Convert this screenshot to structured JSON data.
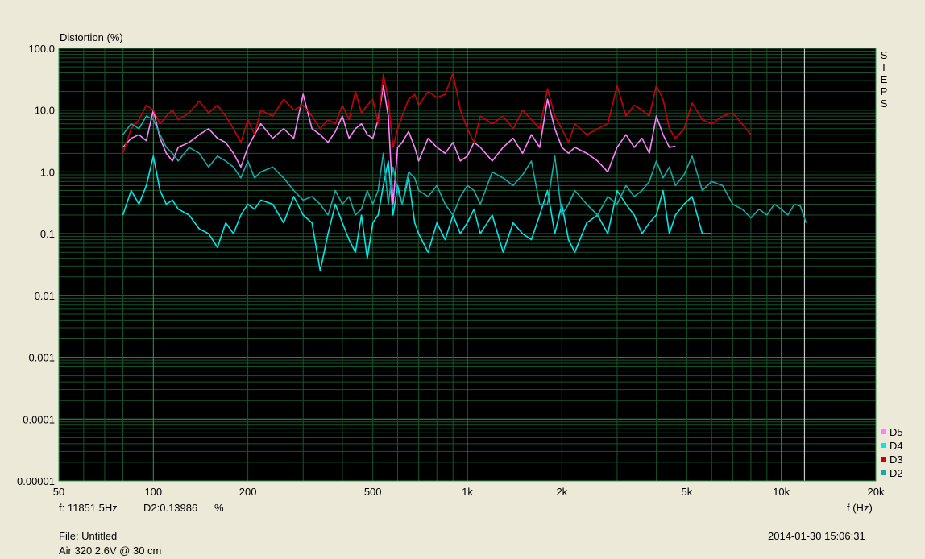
{
  "ylabel": "Distortion (%)",
  "xlabel": "f (Hz)",
  "side_label": "STEPS",
  "cursor": {
    "freq_text": "f: 11851.5Hz",
    "value_text": "D2:0.13986",
    "unit": "%"
  },
  "file_text": "File: Untitled",
  "description": "Air 320 2.6V @ 30 cm",
  "timestamp": "2014-01-30 15:06:31",
  "colors": {
    "background": "#ece9d8",
    "plot": "#000000",
    "grid_major": "#2e9a4e",
    "grid_minor": "#16552a",
    "cursor": "#c8c8c8"
  },
  "chart_data": {
    "type": "line",
    "xscale": "log",
    "yscale": "log",
    "xlim": [
      50,
      20000
    ],
    "ylim": [
      1e-05,
      100
    ],
    "grid": true,
    "legend_position": "bottom-right",
    "x_ticks": [
      {
        "value": 50,
        "label": "50"
      },
      {
        "value": 100,
        "label": "100"
      },
      {
        "value": 200,
        "label": "200"
      },
      {
        "value": 500,
        "label": "500"
      },
      {
        "value": 1000,
        "label": "1k"
      },
      {
        "value": 2000,
        "label": "2k"
      },
      {
        "value": 5000,
        "label": "5k"
      },
      {
        "value": 10000,
        "label": "10k"
      },
      {
        "value": 20000,
        "label": "20k"
      }
    ],
    "y_ticks": [
      {
        "value": 100,
        "label": "100.0"
      },
      {
        "value": 10,
        "label": "10.0"
      },
      {
        "value": 1,
        "label": "1.0"
      },
      {
        "value": 0.1,
        "label": "0.1"
      },
      {
        "value": 0.01,
        "label": "0.01"
      },
      {
        "value": 0.001,
        "label": "0.001"
      },
      {
        "value": 0.0001,
        "label": "0.0001"
      },
      {
        "value": 1e-05,
        "label": "0.00001"
      }
    ],
    "cursor_x": 11851.5,
    "series": [
      {
        "name": "D5",
        "color": "#ff80ff",
        "x": [
          80,
          85,
          90,
          95,
          100,
          105,
          110,
          115,
          120,
          130,
          140,
          150,
          160,
          170,
          180,
          190,
          200,
          210,
          220,
          240,
          260,
          280,
          300,
          320,
          340,
          360,
          380,
          400,
          420,
          440,
          460,
          480,
          500,
          520,
          540,
          560,
          580,
          600,
          620,
          650,
          680,
          700,
          750,
          800,
          850,
          900,
          950,
          1000,
          1050,
          1100,
          1200,
          1300,
          1400,
          1500,
          1600,
          1700,
          1800,
          1900,
          2000,
          2100,
          2200,
          2400,
          2600,
          2800,
          3000,
          3200,
          3400,
          3600,
          3800,
          4000,
          4200,
          4400,
          4600
        ],
        "values": [
          2.5,
          3.5,
          4.0,
          3.2,
          10.0,
          3.5,
          2.0,
          1.5,
          2.5,
          3.0,
          4.0,
          5.0,
          3.5,
          3.0,
          2.0,
          1.2,
          2.5,
          4.0,
          6.0,
          3.5,
          5.0,
          3.5,
          18.0,
          5.0,
          4.0,
          3.0,
          4.5,
          8.0,
          3.5,
          5.0,
          6.0,
          4.0,
          3.5,
          7.0,
          25.0,
          8.0,
          0.3,
          2.5,
          3.0,
          4.5,
          2.5,
          1.5,
          3.5,
          2.5,
          2.0,
          3.0,
          1.5,
          1.8,
          3.0,
          2.5,
          1.5,
          2.5,
          3.5,
          2.0,
          4.0,
          2.5,
          15.0,
          5.0,
          2.5,
          2.0,
          2.5,
          2.0,
          1.5,
          1.0,
          2.5,
          4.0,
          2.5,
          3.5,
          2.0,
          8.0,
          4.0,
          2.5,
          2.6
        ]
      },
      {
        "name": "D4",
        "color": "#00e8e8",
        "x": [
          80,
          85,
          90,
          95,
          100,
          105,
          110,
          115,
          120,
          130,
          140,
          150,
          160,
          170,
          180,
          190,
          200,
          210,
          220,
          240,
          260,
          280,
          300,
          320,
          340,
          360,
          380,
          400,
          420,
          440,
          460,
          480,
          500,
          520,
          540,
          560,
          580,
          600,
          620,
          650,
          680,
          700,
          750,
          800,
          850,
          900,
          950,
          1000,
          1050,
          1100,
          1200,
          1300,
          1400,
          1500,
          1600,
          1700,
          1800,
          1900,
          2000,
          2100,
          2200,
          2400,
          2600,
          2800,
          3000,
          3200,
          3400,
          3600,
          3800,
          4000,
          4200,
          4400,
          4600,
          4900,
          5200,
          5600,
          6000
        ],
        "values": [
          0.2,
          0.5,
          0.3,
          0.6,
          1.8,
          0.5,
          0.3,
          0.35,
          0.25,
          0.2,
          0.12,
          0.1,
          0.06,
          0.15,
          0.1,
          0.2,
          0.3,
          0.25,
          0.35,
          0.3,
          0.15,
          0.4,
          0.2,
          0.15,
          0.025,
          0.1,
          0.3,
          0.15,
          0.08,
          0.05,
          0.2,
          0.04,
          0.15,
          0.2,
          0.6,
          1.5,
          0.2,
          0.6,
          0.3,
          0.8,
          0.15,
          0.1,
          0.05,
          0.15,
          0.08,
          0.2,
          0.1,
          0.15,
          0.25,
          0.1,
          0.2,
          0.05,
          0.15,
          0.1,
          0.08,
          0.2,
          0.5,
          0.1,
          0.3,
          0.08,
          0.05,
          0.15,
          0.2,
          0.1,
          0.5,
          0.3,
          0.2,
          0.1,
          0.15,
          0.2,
          0.5,
          0.1,
          0.2,
          0.3,
          0.4,
          0.1,
          0.1
        ]
      },
      {
        "name": "D3",
        "color": "#c8000a",
        "x": [
          80,
          85,
          90,
          95,
          100,
          105,
          110,
          115,
          120,
          130,
          140,
          150,
          160,
          170,
          180,
          190,
          200,
          210,
          220,
          240,
          260,
          280,
          300,
          320,
          340,
          360,
          380,
          400,
          420,
          440,
          460,
          480,
          500,
          520,
          540,
          560,
          580,
          600,
          620,
          650,
          680,
          700,
          750,
          800,
          850,
          900,
          950,
          1000,
          1050,
          1100,
          1200,
          1300,
          1400,
          1500,
          1600,
          1700,
          1800,
          1900,
          2000,
          2100,
          2200,
          2400,
          2600,
          2800,
          3000,
          3200,
          3400,
          3600,
          3800,
          4000,
          4200,
          4400,
          4600,
          4900,
          5200,
          5600,
          6000,
          6500,
          7000,
          7500,
          8000
        ],
        "values": [
          2.0,
          5.0,
          7.0,
          12.0,
          10.0,
          6.0,
          8.0,
          10.0,
          7.0,
          9.0,
          14.0,
          9.0,
          12.0,
          8.0,
          5.0,
          3.0,
          7.0,
          4.0,
          10.0,
          8.0,
          15.0,
          10.0,
          12.0,
          8.0,
          5.0,
          7.0,
          6.0,
          12.0,
          7.0,
          20.0,
          9.0,
          12.0,
          15.0,
          6.0,
          38.0,
          15.0,
          2.5,
          5.0,
          8.0,
          15.0,
          18.0,
          12.0,
          20.0,
          16.0,
          18.0,
          40.0,
          10.0,
          5.0,
          3.0,
          8.0,
          6.0,
          8.0,
          5.0,
          10.0,
          7.0,
          5.0,
          22.0,
          8.0,
          5.0,
          3.0,
          6.0,
          4.0,
          5.0,
          6.0,
          25.0,
          8.0,
          12.0,
          10.0,
          8.0,
          25.0,
          15.0,
          5.0,
          3.5,
          5.0,
          13.0,
          7.0,
          6.0,
          8.0,
          9.0,
          6.0,
          4.0
        ]
      },
      {
        "name": "D2",
        "color": "#18a8a8",
        "x": [
          80,
          85,
          90,
          95,
          100,
          105,
          110,
          115,
          120,
          130,
          140,
          150,
          160,
          170,
          180,
          190,
          200,
          210,
          220,
          240,
          260,
          280,
          300,
          320,
          340,
          360,
          380,
          400,
          420,
          440,
          460,
          480,
          500,
          520,
          540,
          560,
          580,
          600,
          620,
          650,
          680,
          700,
          750,
          800,
          850,
          900,
          950,
          1000,
          1050,
          1100,
          1200,
          1300,
          1400,
          1500,
          1600,
          1700,
          1800,
          1900,
          2000,
          2100,
          2200,
          2400,
          2600,
          2800,
          3000,
          3200,
          3400,
          3600,
          3800,
          4000,
          4200,
          4400,
          4600,
          4900,
          5200,
          5600,
          6000,
          6500,
          7000,
          7500,
          8000,
          8500,
          9000,
          9500,
          10000,
          10500,
          11000,
          11500,
          12000
        ],
        "values": [
          4.0,
          6.0,
          5.0,
          8.0,
          7.0,
          4.0,
          2.5,
          2.0,
          1.5,
          2.5,
          2.0,
          1.2,
          1.8,
          1.5,
          1.2,
          0.8,
          1.5,
          0.8,
          1.0,
          1.2,
          0.8,
          0.5,
          0.35,
          0.4,
          0.3,
          0.2,
          0.5,
          0.3,
          0.4,
          0.2,
          0.25,
          0.5,
          0.3,
          0.5,
          2.0,
          0.3,
          1.2,
          0.5,
          0.3,
          1.0,
          0.8,
          0.5,
          0.4,
          0.6,
          0.3,
          0.2,
          0.4,
          0.6,
          0.5,
          0.3,
          1.0,
          0.8,
          0.6,
          0.9,
          1.5,
          0.3,
          0.3,
          1.8,
          0.2,
          0.3,
          0.5,
          0.3,
          0.2,
          0.4,
          0.3,
          0.6,
          0.4,
          0.5,
          0.7,
          1.5,
          0.8,
          1.2,
          0.6,
          0.9,
          1.8,
          0.5,
          0.7,
          0.6,
          0.3,
          0.25,
          0.18,
          0.25,
          0.2,
          0.3,
          0.25,
          0.2,
          0.3,
          0.28,
          0.15
        ]
      }
    ]
  }
}
